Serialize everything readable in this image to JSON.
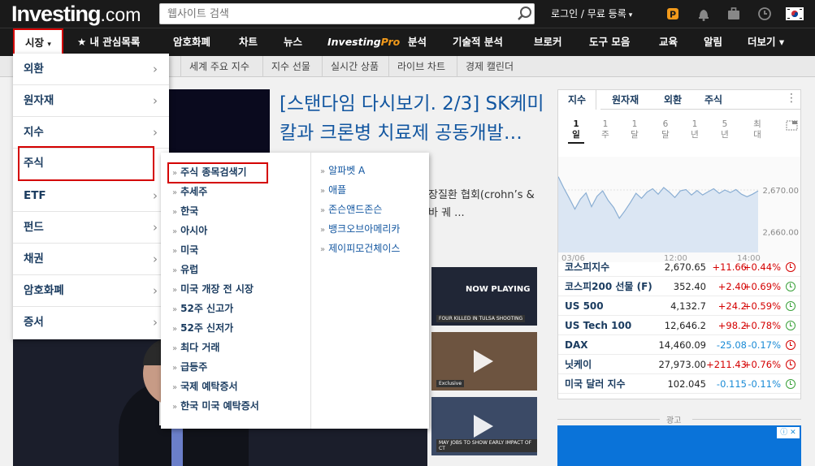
{
  "header": {
    "logo_main": "Investing",
    "logo_suffix": ".com",
    "search_placeholder": "웹사이트 검색",
    "login": "로그인 / 무료 등록",
    "login_caret": "▾"
  },
  "mainnav": {
    "market": "시장",
    "market_caret": "▾",
    "watchlist": "★ 내 관심목록",
    "crypto": "암호화폐",
    "charts": "차트",
    "news": "뉴스",
    "ipro_a": "Investing",
    "ipro_b": "Pro",
    "analysis": "분석",
    "technical": "기술적 분석",
    "brokers": "브로커",
    "tools": "도구 모음",
    "education": "교육",
    "alerts": "알림",
    "more": "더보기 ▾"
  },
  "subnav": {
    "items": [
      "세계 주요 지수",
      "지수 선물",
      "실시간 상품",
      "라이브 차트",
      "경제 캘린더"
    ]
  },
  "article": {
    "headline": "[스탠다임 다시보기. 2/3] SK케미칼과 크론병 치료제 공동개발…",
    "snippet_1": "장질환 협회(crohn’s &",
    "snippet_2": "바 궤 ..."
  },
  "thumbs": {
    "now_playing": "NOW PLAYING",
    "cap1": "FOUR KILLED IN TULSA SHOOTING",
    "cap2": "Exclusive",
    "cap3": "MAY JOBS TO SHOW EARLY IMPACT OF CT"
  },
  "menu": {
    "items": [
      {
        "label": "외환",
        "chev": "›"
      },
      {
        "label": "원자재",
        "chev": "›"
      },
      {
        "label": "지수",
        "chev": "›"
      },
      {
        "label": "주식",
        "chev": "›"
      },
      {
        "label": "ETF",
        "chev": "›"
      },
      {
        "label": "펀드",
        "chev": "›"
      },
      {
        "label": "채권",
        "chev": "›"
      },
      {
        "label": "암호화폐",
        "chev": "›"
      },
      {
        "label": "증서",
        "chev": "›"
      }
    ]
  },
  "submenu": {
    "arrow": "»",
    "left": [
      "주식 종목검색기",
      "추세주",
      "한국",
      "아시아",
      "미국",
      "유럽",
      "미국 개장 전 시장",
      "52주 신고가",
      "52주 신저가",
      "최다 거래",
      "급등주",
      "국제 예탁증서",
      "한국 미국 예탁증서"
    ],
    "right": [
      "알파벳 A",
      "애플",
      "존슨앤드존슨",
      "뱅크오브아메리카",
      "제이피모건체이스"
    ]
  },
  "panel": {
    "tabs": [
      "지수",
      "원자재",
      "외환",
      "주식"
    ],
    "more": "⋮",
    "periods": [
      {
        "l1": "1",
        "l2": "일"
      },
      {
        "l1": "1",
        "l2": "주"
      },
      {
        "l1": "1",
        "l2": "달"
      },
      {
        "l1": "6",
        "l2": "달"
      },
      {
        "l1": "1",
        "l2": "년"
      },
      {
        "l1": "5",
        "l2": "년"
      },
      {
        "l1": "최",
        "l2": "대"
      }
    ],
    "quotes": [
      {
        "name": "코스피지수",
        "last": "2,670.65",
        "chg": "+11.66",
        "pct": "+0.44%",
        "dir": "up",
        "status": "closed"
      },
      {
        "name": "코스피200 선물 (F)",
        "last": "352.40",
        "chg": "+2.40",
        "pct": "+0.69%",
        "dir": "up",
        "status": "open"
      },
      {
        "name": "US 500",
        "last": "4,132.7",
        "chg": "+24.2",
        "pct": "+0.59%",
        "dir": "up",
        "status": "open"
      },
      {
        "name": "US Tech 100",
        "last": "12,646.2",
        "chg": "+98.2",
        "pct": "+0.78%",
        "dir": "up",
        "status": "open"
      },
      {
        "name": "DAX",
        "last": "14,460.09",
        "chg": "-25.08",
        "pct": "-0.17%",
        "dir": "down",
        "status": "closed"
      },
      {
        "name": "닛케이",
        "last": "27,973.00",
        "chg": "+211.43",
        "pct": "+0.76%",
        "dir": "up",
        "status": "closed"
      },
      {
        "name": "미국 달러 지수",
        "last": "102.045",
        "chg": "-0.115",
        "pct": "-0.11%",
        "dir": "down",
        "status": "open"
      }
    ]
  },
  "chart_data": {
    "type": "area",
    "title": "",
    "xlabel": "",
    "ylabel": "",
    "x_ticks": [
      "03/06",
      "12:00",
      "14:00"
    ],
    "y_ticks": [
      2670.0,
      2660.0
    ],
    "ylim": [
      2655,
      2678
    ],
    "values": [
      2673.2,
      2670.5,
      2668.0,
      2665.4,
      2667.8,
      2669.3,
      2666.0,
      2668.5,
      2669.8,
      2667.5,
      2665.8,
      2663.2,
      2665.0,
      2667.0,
      2669.2,
      2668.0,
      2669.5,
      2670.3,
      2669.0,
      2670.6,
      2669.5,
      2668.2,
      2669.8,
      2670.1,
      2668.8,
      2669.9,
      2668.8,
      2669.6,
      2670.3,
      2669.2,
      2670.0,
      2669.4,
      2670.1,
      2669.0,
      2668.4,
      2669.0,
      2669.8
    ],
    "fill_color": "#dbe6f3",
    "line_color": "#8aaed3",
    "grid": true,
    "legend": "none"
  },
  "ad": {
    "label": "광고",
    "close": "ⓘ ✕"
  },
  "colors": {
    "bar": "#1a1a1a",
    "accent_red": "#d40000",
    "link_blue": "#1256a0",
    "positive": "#d40000",
    "negative": "#1a8bd6",
    "investingpro_orange": "#f29a1b"
  }
}
